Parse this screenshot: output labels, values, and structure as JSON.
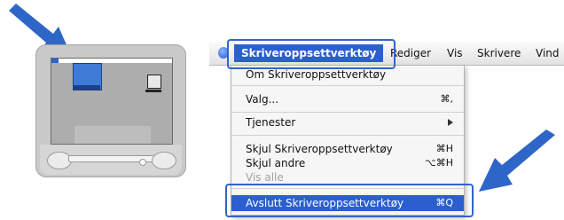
{
  "illustration": {
    "accent_color": "#2e66c8",
    "arrow_color": "#2e66c8"
  },
  "menubar": {
    "active_menu": "Skriveroppsettverktøy",
    "menus": [
      "Rediger",
      "Vis",
      "Skrivere",
      "Vind"
    ]
  },
  "menu": {
    "items": [
      {
        "label": "Om Skriveroppsettverktøy",
        "shortcut": ""
      },
      {
        "label": "Valg...",
        "shortcut": "⌘,"
      },
      {
        "label": "Tjenester",
        "shortcut": ""
      },
      {
        "label": "Skjul Skriveroppsettverktøy",
        "shortcut": "⌘H"
      },
      {
        "label": "Skjul andre",
        "shortcut": "⌥⌘H"
      },
      {
        "label": "Vis alle",
        "shortcut": ""
      },
      {
        "label": "Avslutt Skriveroppsettverktøy",
        "shortcut": "⌘Q"
      }
    ]
  }
}
